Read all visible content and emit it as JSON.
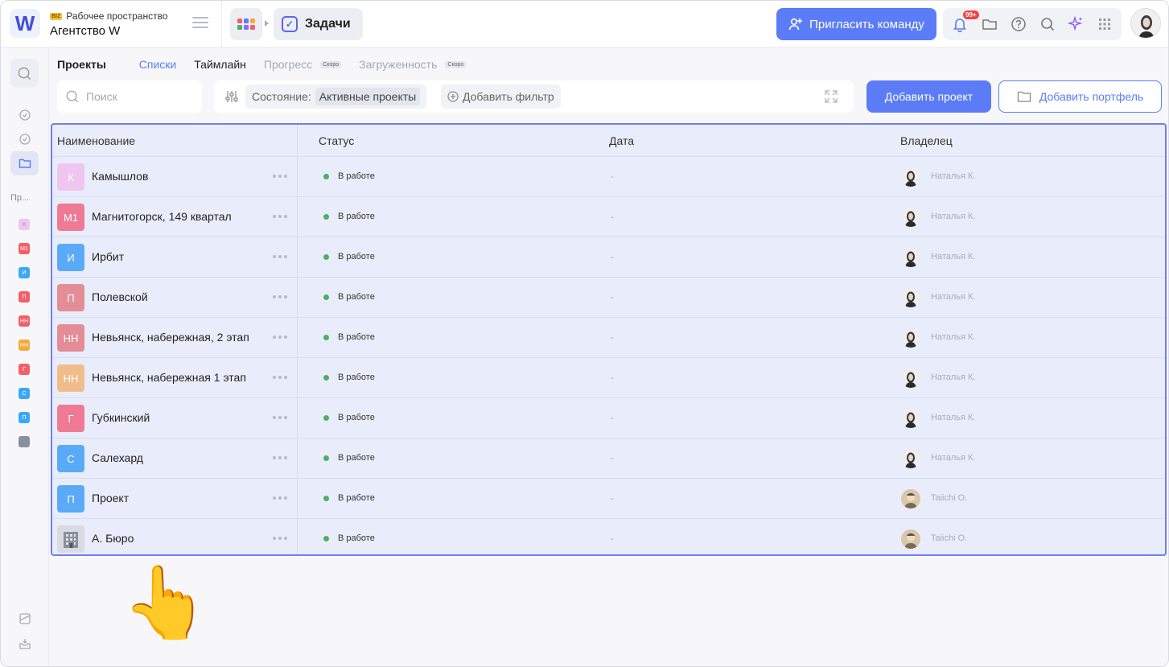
{
  "workspace": {
    "badge": "BIZ",
    "label": "Рабочее пространство",
    "name": "Агентство W",
    "logo_letter": "W"
  },
  "breadcrumb": {
    "current": "Задачи"
  },
  "header": {
    "invite_label": "Пригласить команду",
    "notifications_badge": "99+"
  },
  "subnav": {
    "projects": "Проекты",
    "lists": "Списки",
    "timeline": "Таймлайн",
    "progress": "Прогресс",
    "workload": "Загруженность",
    "soon": "Скоро"
  },
  "search": {
    "placeholder": "Поиск"
  },
  "filters": {
    "state_label": "Состояние:",
    "state_value": "Активные проекты",
    "add_filter": "Добавить фильтр"
  },
  "actions": {
    "add_project": "Добавить проект",
    "add_portfolio": "Добавить портфель"
  },
  "rail": {
    "section_label": "Пр...",
    "items": [
      "К",
      "М1",
      "И",
      "П",
      "НН",
      "НН",
      "Г",
      "С",
      "П"
    ]
  },
  "table": {
    "columns": [
      "Наименование",
      "Статус",
      "Дата",
      "Владелец"
    ],
    "rows": [
      {
        "initials": "К",
        "color": "#efc6ef",
        "name": "Камышлов",
        "status": "В работе",
        "date": "-",
        "owner": "Наталья К."
      },
      {
        "initials": "М1",
        "color": "#f07a93",
        "name": "Магнитогорск, 149 квартал",
        "status": "В работе",
        "date": "-",
        "owner": "Наталья К."
      },
      {
        "initials": "И",
        "color": "#5aaaf8",
        "name": "Ирбит",
        "status": "В работе",
        "date": "-",
        "owner": "Наталья К."
      },
      {
        "initials": "П",
        "color": "#e48d96",
        "name": "Полевской",
        "status": "В работе",
        "date": "-",
        "owner": "Наталья К."
      },
      {
        "initials": "НН",
        "color": "#e48d96",
        "name": "Невьянск, набережная, 2 этап",
        "status": "В работе",
        "date": "-",
        "owner": "Наталья К."
      },
      {
        "initials": "НН",
        "color": "#f0bd8a",
        "name": "Невьянск, набережная 1 этап",
        "status": "В работе",
        "date": "-",
        "owner": "Наталья К."
      },
      {
        "initials": "Г",
        "color": "#f07a93",
        "name": "Губкинский",
        "status": "В работе",
        "date": "-",
        "owner": "Наталья К."
      },
      {
        "initials": "С",
        "color": "#5aaaf8",
        "name": "Салехард",
        "status": "В работе",
        "date": "-",
        "owner": "Наталья К."
      },
      {
        "initials": "П",
        "color": "#5aaaf8",
        "name": "Проект",
        "status": "В работе",
        "date": "-",
        "owner": "Taiichi O."
      },
      {
        "initials": "",
        "color": "#d9dbe3",
        "name": "А. Бюро",
        "status": "В работе",
        "date": "-",
        "owner": "Taiichi O."
      }
    ]
  },
  "colors": {
    "accent": "#5b7cf6",
    "status_green": "#4caf64",
    "selection": "#e9edfb"
  },
  "pointer": "👆"
}
